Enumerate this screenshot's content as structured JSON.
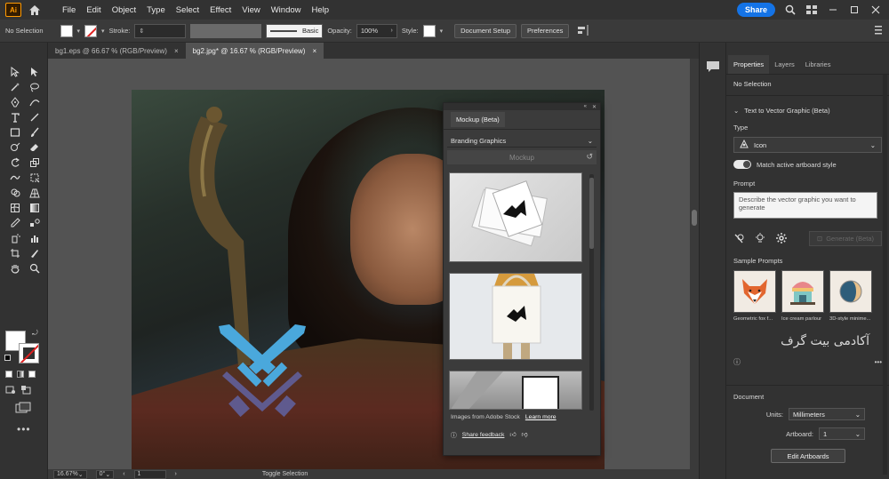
{
  "menubar": {
    "logo": "Ai",
    "items": [
      "File",
      "Edit",
      "Object",
      "Type",
      "Select",
      "Effect",
      "View",
      "Window",
      "Help"
    ],
    "share_label": "Share"
  },
  "controlbar": {
    "selection": "No Selection",
    "stroke_label": "Stroke:",
    "profile": "Basic",
    "opacity_label": "Opacity:",
    "opacity_value": "100%",
    "style_label": "Style:",
    "document_setup": "Document Setup",
    "preferences": "Preferences"
  },
  "tabs": [
    {
      "label": "bg1.eps @ 66.67 % (RGB/Preview)",
      "close": "×"
    },
    {
      "label": "bg2.jpg* @ 16.67 % (RGB/Preview)",
      "close": "×"
    }
  ],
  "tools_more": "•••",
  "mockup_panel": {
    "tab": "Mockup (Beta)",
    "category": "Branding Graphics",
    "mockup_label": "Mockup",
    "stock_text": "Images from Adobe Stock",
    "learn_more": "Learn more",
    "share_feedback": "Share feedback"
  },
  "statusbar": {
    "zoom": "16.67%",
    "rotation": "0°",
    "artboard_num": "1",
    "toggle_label": "Toggle Selection"
  },
  "properties": {
    "tabs": [
      "Properties",
      "Layers",
      "Libraries"
    ],
    "selection": "No Selection",
    "ttv_title": "Text to Vector Graphic (Beta)",
    "type_label": "Type",
    "type_value": "Icon",
    "match_label": "Match active artboard style",
    "prompt_label": "Prompt",
    "prompt_placeholder": "Describe the vector graphic you want to generate",
    "generate_label": "Generate (Beta)",
    "sample_label": "Sample Prompts",
    "samples": [
      {
        "caption": "Geometric fox f..."
      },
      {
        "caption": "Ice cream parlour"
      },
      {
        "caption": "3D-style minime..."
      }
    ],
    "watermark": "آکادمی بیت گرف",
    "document_label": "Document",
    "units_label": "Units:",
    "units_value": "Millimeters",
    "artboard_label": "Artboard:",
    "artboard_value": "1",
    "edit_artboards": "Edit Artboards"
  },
  "colors": {
    "accent": "#1473e6",
    "logo": "#ff9a00",
    "swords_blue": "#4aa8dc",
    "swords_purple": "#5f5a8e"
  }
}
